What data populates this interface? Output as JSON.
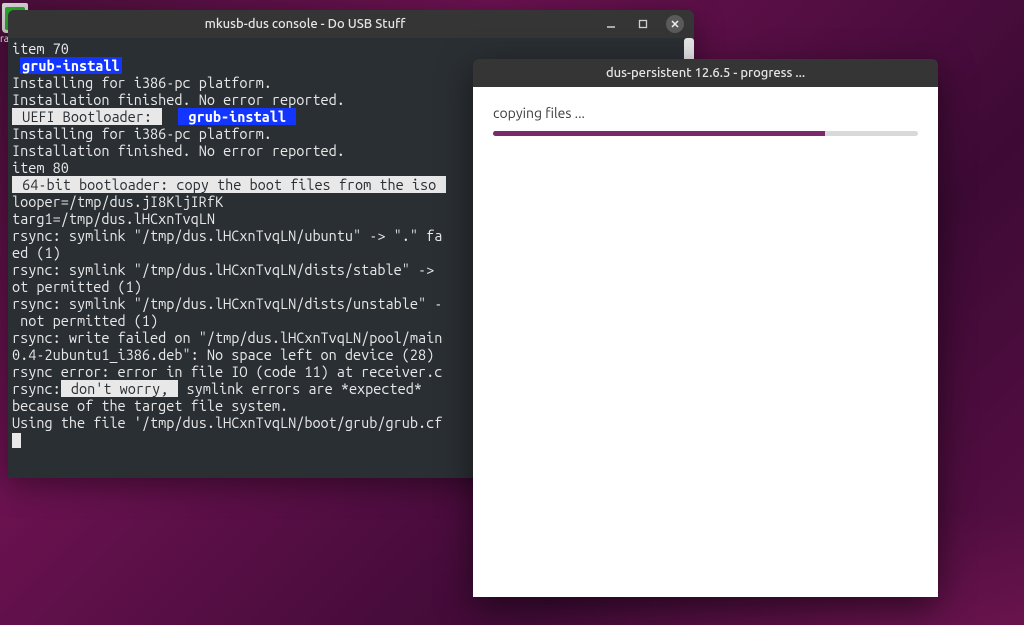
{
  "desktop": {
    "icon_label": "ras"
  },
  "console": {
    "title": "mkusb-dus console - Do USB Stuff",
    "lines": {
      "l1": "item 70",
      "l2": "grub-install",
      "l3": "Installing for i386-pc platform.",
      "l4": "Installation finished. No error reported.",
      "l5a": " UEFI Bootloader: ",
      "l5b": " grub-install ",
      "l6": "Installing for i386-pc platform.",
      "l7": "Installation finished. No error reported.",
      "l8": "item 80",
      "l9": " 64-bit bootloader: copy the boot files from the iso ",
      "l10": "looper=/tmp/dus.jI8KljIRfK",
      "l11": "targ1=/tmp/dus.lHCxnTvqLN",
      "l12": "rsync: symlink \"/tmp/dus.lHCxnTvqLN/ubuntu\" -> \".\" fa",
      "l13": "ed (1)",
      "l14": "rsync: symlink \"/tmp/dus.lHCxnTvqLN/dists/stable\" -> ",
      "l15": "ot permitted (1)",
      "l16": "rsync: symlink \"/tmp/dus.lHCxnTvqLN/dists/unstable\" -",
      "l17": " not permitted (1)",
      "l18": "rsync: write failed on \"/tmp/dus.lHCxnTvqLN/pool/main",
      "l19": "0.4-2ubuntu1_i386.deb\": No space left on device (28)",
      "l20": "rsync error: error in file IO (code 11) at receiver.c",
      "l21a": "rsync:",
      "l21b": " don't worry, ",
      "l21c": " symlink errors are *expected*",
      "l22": "because of the target file system.",
      "l23": "Using the file '/tmp/dus.lHCxnTvqLN/boot/grub/grub.cf"
    },
    "controls": {
      "minimize": "–",
      "maximize": "☐",
      "close": "✕"
    }
  },
  "progress": {
    "title": "dus-persistent 12.6.5 - progress ...",
    "label": "copying files ...",
    "percent": 78
  },
  "colors": {
    "accent": "#7a2a6a",
    "term_bg": "#2a2f33"
  }
}
